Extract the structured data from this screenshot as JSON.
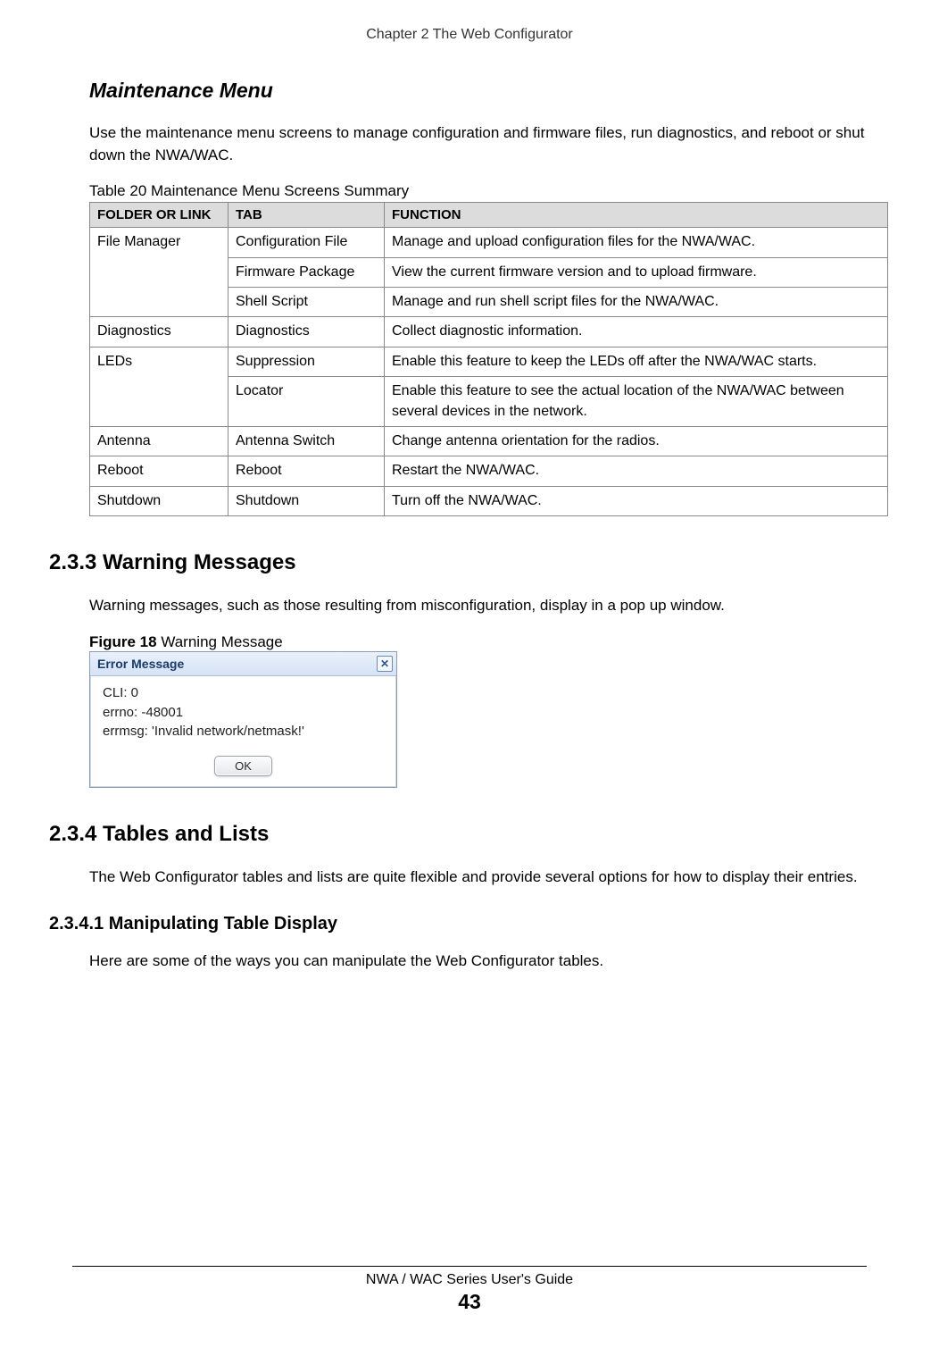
{
  "page_header": "Chapter 2 The Web Configurator",
  "s1_title": "Maintenance Menu",
  "s1_intro": "Use the maintenance menu screens to manage configuration and firmware files, run diagnostics, and reboot or shut down the NWA/WAC.",
  "table_caption": "Table 20   Maintenance Menu Screens Summary",
  "th": {
    "folder": "FOLDER OR LINK",
    "tab": "TAB",
    "func": "FUNCTION"
  },
  "rows": {
    "r1": {
      "folder": "File Manager",
      "tab": "Configuration File",
      "func": "Manage and upload configuration files for the NWA/WAC."
    },
    "r2": {
      "tab": "Firmware Package",
      "func": "View the current firmware version and to upload firmware."
    },
    "r3": {
      "tab": "Shell Script",
      "func": "Manage and run shell script files for the NWA/WAC."
    },
    "r4": {
      "folder": "Diagnostics",
      "tab": "Diagnostics",
      "func": "Collect diagnostic information."
    },
    "r5": {
      "folder": "LEDs",
      "tab": "Suppression",
      "func": "Enable this feature to keep the LEDs off after the NWA/WAC starts."
    },
    "r6": {
      "tab": "Locator",
      "func": "Enable this feature to see the actual location of the NWA/WAC between several devices in the network."
    },
    "r7": {
      "folder": "Antenna",
      "tab": "Antenna Switch",
      "func": "Change antenna orientation for the radios."
    },
    "r8": {
      "folder": "Reboot",
      "tab": "Reboot",
      "func": "Restart the NWA/WAC."
    },
    "r9": {
      "folder": "Shutdown",
      "tab": "Shutdown",
      "func": "Turn off the NWA/WAC."
    }
  },
  "h233_num": "2.3.3  ",
  "h233_title": "Warning Messages",
  "h233_body": "Warning messages, such as those resulting from misconfiguration, display in a pop up window.",
  "fig_label": "Figure 18",
  "fig_title": "   Warning Message",
  "dialog": {
    "title": "Error Message",
    "line1": "CLI: 0",
    "line2": "errno: -48001",
    "line3": "errmsg: 'Invalid network/netmask!'",
    "ok": "OK"
  },
  "h234_num": "2.3.4  ",
  "h234_title": "Tables and Lists",
  "h234_body": "The Web Configurator tables and lists are quite flexible and provide several options for how to display their entries.",
  "h2341_num": "2.3.4.1  ",
  "h2341_title": "Manipulating Table Display",
  "h2341_body": "Here are some of the ways you can manipulate the Web Configurator tables.",
  "footer_title": "NWA / WAC Series User's Guide",
  "page_number": "43"
}
